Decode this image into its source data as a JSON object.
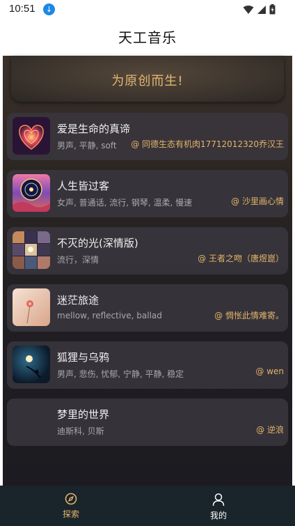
{
  "status_bar": {
    "time": "10:51",
    "icons": [
      "download-icon",
      "wifi-icon",
      "signal-icon",
      "battery-icon"
    ]
  },
  "header": {
    "title": "天工音乐"
  },
  "banner": {
    "text": "为原创而生!"
  },
  "songs": [
    {
      "title": "爱是生命的真谛",
      "tags": "男声, 平静, soft",
      "artist": "@ 同德生态有机肉17712012320乔汉王",
      "cover": "heart"
    },
    {
      "title": "人生皆过客",
      "tags": "女声, 普通话, 流行, 钢琴, 温柔, 慢速",
      "artist": "@ 沙里画心情",
      "cover": "cosmic"
    },
    {
      "title": "不灭的光(深情版)",
      "tags": "流行，深情",
      "artist": "@ 王者之吻（唐煜崑）",
      "cover": "grid"
    },
    {
      "title": "迷茫旅途",
      "tags": "mellow, reflective, ballad",
      "artist": "@ 惆怅此情难寄。",
      "cover": "flower"
    },
    {
      "title": "狐狸与乌鸦",
      "tags": "男声, 悲伤, 忧郁, 宁静, 平静, 稳定",
      "artist": "@ wen",
      "cover": "moon"
    },
    {
      "title": "梦里的世界",
      "tags": "迪斯科, 贝斯",
      "artist": "@ 逆浪",
      "cover": "none"
    }
  ],
  "bottom_nav": {
    "explore_label": "探索",
    "mine_label": "我的"
  },
  "colors": {
    "accent": "#e3b469",
    "nav_background": "#19242b",
    "card_background": "#3a363e"
  }
}
